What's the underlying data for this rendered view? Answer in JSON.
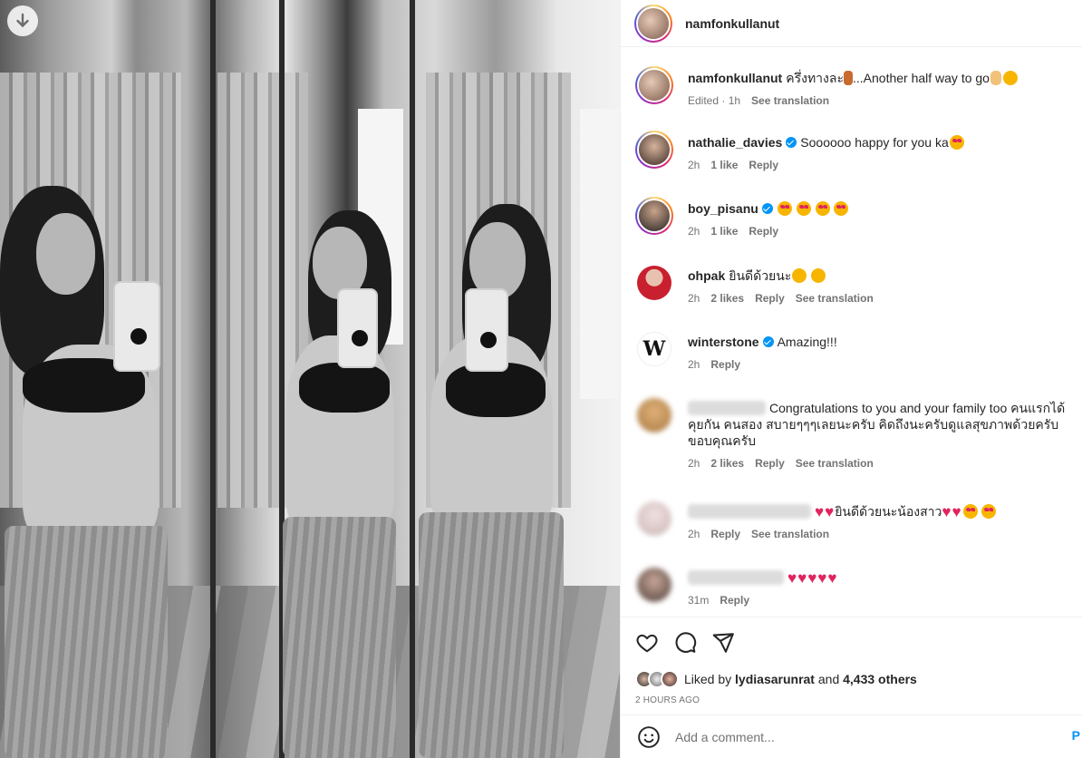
{
  "post": {
    "author": "namfonkullanut",
    "caption_text": "ครึ่งทางละ",
    "caption_text2": "...Another half way to go",
    "caption_edited": "Edited · 1h",
    "see_translation": "See translation"
  },
  "comments": [
    {
      "user": "nathalie_davies",
      "verified": true,
      "text": "Soooooo happy for you ka",
      "emojis": [
        "heart-eyes-emoji"
      ],
      "time": "2h",
      "likes": "1 like",
      "reply": "Reply",
      "translation": ""
    },
    {
      "user": "boy_pisanu",
      "verified": true,
      "text": "",
      "emojis": [
        "heart-eyes-emoji",
        "heart-eyes-emoji",
        "heart-eyes-emoji",
        "heart-eyes-emoji"
      ],
      "time": "2h",
      "likes": "1 like",
      "reply": "Reply",
      "translation": ""
    },
    {
      "user": "ohpak",
      "verified": false,
      "text": "ยินดีด้วยนะ",
      "emojis": [
        "kiss-emoji",
        "kiss-emoji"
      ],
      "time": "2h",
      "likes": "2 likes",
      "reply": "Reply",
      "translation": "See translation"
    },
    {
      "user": "winterstone",
      "verified": true,
      "text": "Amazing!!!",
      "emojis": [],
      "time": "2h",
      "likes": "",
      "reply": "Reply",
      "translation": ""
    },
    {
      "user": "",
      "verified": false,
      "text": "Congratulations to you and your family too คนแรกได้คุยกัน คนสอง สบายๆๆๆเลยนะครับ คิดถึงนะครับดูแลสุขภาพด้วยครับ ขอบคุณครับ",
      "emojis": [],
      "time": "2h",
      "likes": "2 likes",
      "reply": "Reply",
      "translation": "See translation"
    },
    {
      "user": "",
      "verified": false,
      "text": "ยินดีด้วยนะน้องสาว",
      "emojis": [],
      "time": "2h",
      "likes": "",
      "reply": "Reply",
      "translation": "See translation"
    },
    {
      "user": "",
      "verified": false,
      "text": "",
      "emojis": [],
      "time": "31m",
      "likes": "",
      "reply": "Reply",
      "translation": ""
    }
  ],
  "actions": {
    "like_icon": "heart-icon",
    "comment_icon": "comment-icon",
    "share_icon": "send-icon",
    "liked_by_prefix": "Liked by",
    "liked_by_user": "lydiasarunrat",
    "liked_by_and": "and",
    "liked_by_others": "4,433 others",
    "timestamp": "2 HOURS AGO"
  },
  "composer": {
    "emoji_icon": "smiley-icon",
    "placeholder": "Add a comment...",
    "post_label": "P"
  },
  "colors": {
    "link_blue": "#0095f6",
    "muted": "#737373",
    "heart_red": "#e0245e"
  }
}
